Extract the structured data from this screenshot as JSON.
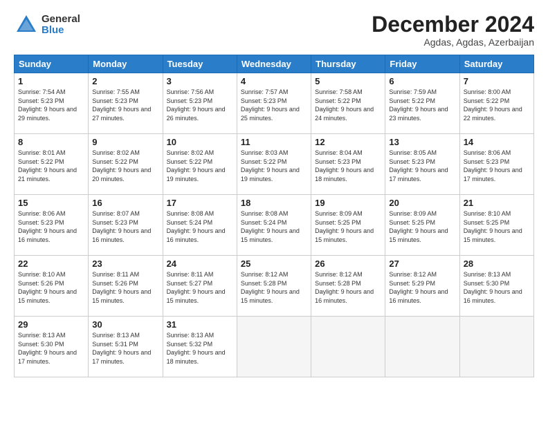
{
  "header": {
    "logo": {
      "general": "General",
      "blue": "Blue"
    },
    "title": "December 2024",
    "location": "Agdas, Agdas, Azerbaijan"
  },
  "days_of_week": [
    "Sunday",
    "Monday",
    "Tuesday",
    "Wednesday",
    "Thursday",
    "Friday",
    "Saturday"
  ],
  "weeks": [
    [
      {
        "day": "1",
        "sunrise": "7:54 AM",
        "sunset": "5:23 PM",
        "daylight": "9 hours and 29 minutes."
      },
      {
        "day": "2",
        "sunrise": "7:55 AM",
        "sunset": "5:23 PM",
        "daylight": "9 hours and 27 minutes."
      },
      {
        "day": "3",
        "sunrise": "7:56 AM",
        "sunset": "5:23 PM",
        "daylight": "9 hours and 26 minutes."
      },
      {
        "day": "4",
        "sunrise": "7:57 AM",
        "sunset": "5:23 PM",
        "daylight": "9 hours and 25 minutes."
      },
      {
        "day": "5",
        "sunrise": "7:58 AM",
        "sunset": "5:22 PM",
        "daylight": "9 hours and 24 minutes."
      },
      {
        "day": "6",
        "sunrise": "7:59 AM",
        "sunset": "5:22 PM",
        "daylight": "9 hours and 23 minutes."
      },
      {
        "day": "7",
        "sunrise": "8:00 AM",
        "sunset": "5:22 PM",
        "daylight": "9 hours and 22 minutes."
      }
    ],
    [
      {
        "day": "8",
        "sunrise": "8:01 AM",
        "sunset": "5:22 PM",
        "daylight": "9 hours and 21 minutes."
      },
      {
        "day": "9",
        "sunrise": "8:02 AM",
        "sunset": "5:22 PM",
        "daylight": "9 hours and 20 minutes."
      },
      {
        "day": "10",
        "sunrise": "8:02 AM",
        "sunset": "5:22 PM",
        "daylight": "9 hours and 19 minutes."
      },
      {
        "day": "11",
        "sunrise": "8:03 AM",
        "sunset": "5:22 PM",
        "daylight": "9 hours and 19 minutes."
      },
      {
        "day": "12",
        "sunrise": "8:04 AM",
        "sunset": "5:23 PM",
        "daylight": "9 hours and 18 minutes."
      },
      {
        "day": "13",
        "sunrise": "8:05 AM",
        "sunset": "5:23 PM",
        "daylight": "9 hours and 17 minutes."
      },
      {
        "day": "14",
        "sunrise": "8:06 AM",
        "sunset": "5:23 PM",
        "daylight": "9 hours and 17 minutes."
      }
    ],
    [
      {
        "day": "15",
        "sunrise": "8:06 AM",
        "sunset": "5:23 PM",
        "daylight": "9 hours and 16 minutes."
      },
      {
        "day": "16",
        "sunrise": "8:07 AM",
        "sunset": "5:23 PM",
        "daylight": "9 hours and 16 minutes."
      },
      {
        "day": "17",
        "sunrise": "8:08 AM",
        "sunset": "5:24 PM",
        "daylight": "9 hours and 16 minutes."
      },
      {
        "day": "18",
        "sunrise": "8:08 AM",
        "sunset": "5:24 PM",
        "daylight": "9 hours and 15 minutes."
      },
      {
        "day": "19",
        "sunrise": "8:09 AM",
        "sunset": "5:25 PM",
        "daylight": "9 hours and 15 minutes."
      },
      {
        "day": "20",
        "sunrise": "8:09 AM",
        "sunset": "5:25 PM",
        "daylight": "9 hours and 15 minutes."
      },
      {
        "day": "21",
        "sunrise": "8:10 AM",
        "sunset": "5:25 PM",
        "daylight": "9 hours and 15 minutes."
      }
    ],
    [
      {
        "day": "22",
        "sunrise": "8:10 AM",
        "sunset": "5:26 PM",
        "daylight": "9 hours and 15 minutes."
      },
      {
        "day": "23",
        "sunrise": "8:11 AM",
        "sunset": "5:26 PM",
        "daylight": "9 hours and 15 minutes."
      },
      {
        "day": "24",
        "sunrise": "8:11 AM",
        "sunset": "5:27 PM",
        "daylight": "9 hours and 15 minutes."
      },
      {
        "day": "25",
        "sunrise": "8:12 AM",
        "sunset": "5:28 PM",
        "daylight": "9 hours and 15 minutes."
      },
      {
        "day": "26",
        "sunrise": "8:12 AM",
        "sunset": "5:28 PM",
        "daylight": "9 hours and 16 minutes."
      },
      {
        "day": "27",
        "sunrise": "8:12 AM",
        "sunset": "5:29 PM",
        "daylight": "9 hours and 16 minutes."
      },
      {
        "day": "28",
        "sunrise": "8:13 AM",
        "sunset": "5:30 PM",
        "daylight": "9 hours and 16 minutes."
      }
    ],
    [
      {
        "day": "29",
        "sunrise": "8:13 AM",
        "sunset": "5:30 PM",
        "daylight": "9 hours and 17 minutes."
      },
      {
        "day": "30",
        "sunrise": "8:13 AM",
        "sunset": "5:31 PM",
        "daylight": "9 hours and 17 minutes."
      },
      {
        "day": "31",
        "sunrise": "8:13 AM",
        "sunset": "5:32 PM",
        "daylight": "9 hours and 18 minutes."
      },
      null,
      null,
      null,
      null
    ]
  ],
  "labels": {
    "sunrise": "Sunrise:",
    "sunset": "Sunset:",
    "daylight": "Daylight:"
  }
}
